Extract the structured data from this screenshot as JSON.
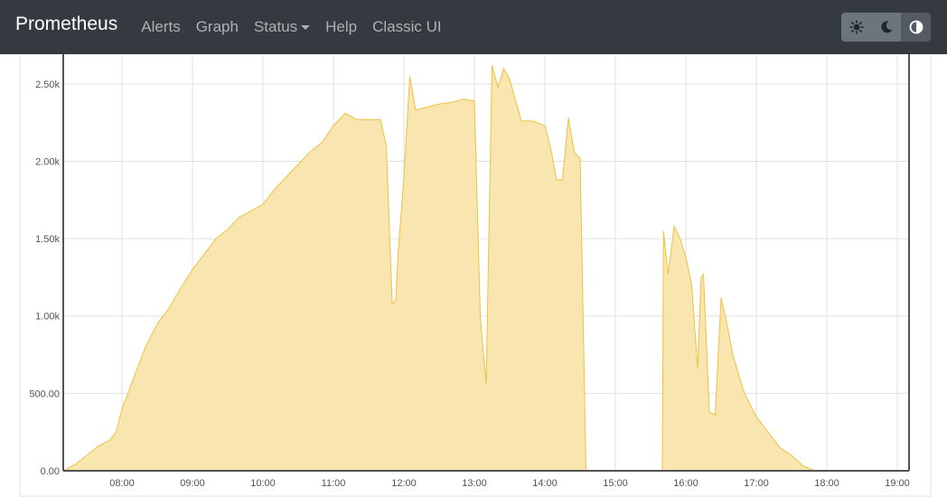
{
  "navbar": {
    "brand": "Prometheus",
    "links": [
      {
        "label": "Alerts"
      },
      {
        "label": "Graph"
      },
      {
        "label": "Status"
      },
      {
        "label": "Help"
      },
      {
        "label": "Classic UI"
      }
    ],
    "theme_buttons": [
      {
        "icon": "sun-icon",
        "active": false
      },
      {
        "icon": "moon-icon",
        "active": false
      },
      {
        "icon": "adjust-icon",
        "active": true
      }
    ]
  },
  "colors": {
    "navbar_bg": "#343a40",
    "series_fill": "#f8e5b0",
    "series_line": "#edc240",
    "grid": "#e0e0e0"
  },
  "chart_data": {
    "type": "area",
    "xlim": [
      "07:10",
      "19:10"
    ],
    "ylim": [
      0,
      2750
    ],
    "x_ticks": [
      "08:00",
      "09:00",
      "10:00",
      "11:00",
      "12:00",
      "13:00",
      "14:00",
      "15:00",
      "16:00",
      "17:00",
      "18:00",
      "19:00"
    ],
    "y_ticks": [
      {
        "value": 0,
        "label": "0.00"
      },
      {
        "value": 500,
        "label": "500.00"
      },
      {
        "value": 1000,
        "label": "1.00k"
      },
      {
        "value": 1500,
        "label": "1.50k"
      },
      {
        "value": 2000,
        "label": "2.00k"
      },
      {
        "value": 2500,
        "label": "2.50k"
      }
    ],
    "grid": true,
    "series": [
      {
        "x": [
          "07:10",
          "07:20",
          "07:30",
          "07:40",
          "07:50",
          "07:55",
          "08:00",
          "08:10",
          "08:20",
          "08:30",
          "08:40",
          "08:50",
          "09:00",
          "09:10",
          "09:20",
          "09:30",
          "09:40",
          "09:50",
          "10:00",
          "10:10",
          "10:20",
          "10:30",
          "10:40",
          "10:50",
          "11:00",
          "11:10",
          "11:20",
          "11:30",
          "11:40",
          "11:45",
          "11:50",
          "11:53",
          "11:55",
          "12:00",
          "12:05",
          "12:10",
          "12:20",
          "12:30",
          "12:40",
          "12:50",
          "13:00",
          "13:05",
          "13:10",
          "13:15",
          "13:20",
          "13:25",
          "13:30",
          "13:40",
          "13:50",
          "14:00",
          "14:05",
          "14:10",
          "14:15",
          "14:20",
          "14:25",
          "14:30",
          "14:35",
          "14:40",
          "14:41",
          "14:45",
          "15:00",
          "15:15",
          "15:30",
          "15:40",
          "15:41",
          "15:45",
          "15:50",
          "15:55",
          "16:00",
          "16:05",
          "16:10",
          "16:13",
          "16:15",
          "16:20",
          "16:25",
          "16:30",
          "16:35",
          "16:40",
          "16:45",
          "16:50",
          "17:00",
          "17:10",
          "17:20",
          "17:30",
          "17:40",
          "17:50",
          "18:00",
          "18:10",
          "18:20",
          "18:30",
          "18:40",
          "18:45",
          "18:50"
        ],
        "values": [
          0,
          40,
          100,
          160,
          200,
          250,
          400,
          600,
          800,
          950,
          1050,
          1180,
          1300,
          1400,
          1500,
          1560,
          1640,
          1680,
          1720,
          1820,
          1900,
          1980,
          2060,
          2120,
          2230,
          2310,
          2270,
          2270,
          2270,
          2100,
          1080,
          1100,
          1400,
          1900,
          2550,
          2330,
          2350,
          2370,
          2380,
          2400,
          2390,
          1000,
          560,
          2620,
          2480,
          2600,
          2530,
          2260,
          2260,
          2230,
          2080,
          1880,
          1880,
          2280,
          2060,
          2020,
          0,
          0,
          0,
          0,
          0,
          0,
          0,
          0,
          1550,
          1270,
          1580,
          1500,
          1380,
          1200,
          660,
          1250,
          1270,
          380,
          360,
          1120,
          950,
          750,
          620,
          500,
          350,
          250,
          150,
          100,
          30,
          0,
          0,
          0,
          0,
          0,
          0,
          0,
          0
        ]
      }
    ]
  }
}
